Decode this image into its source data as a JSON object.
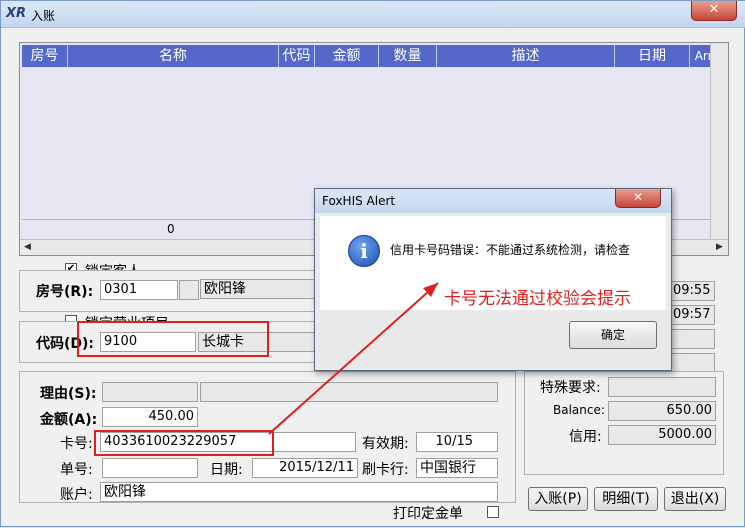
{
  "window": {
    "title": "入账",
    "close_label": "✕"
  },
  "grid": {
    "columns": [
      "房号",
      "名称",
      "代码",
      "金额",
      "数量",
      "描述",
      "日期",
      "Arr."
    ],
    "sum_qty": "0"
  },
  "guest": {
    "lock_label": "锁定客人",
    "lock_checked": "✔",
    "room_label": "房号(R):",
    "room_value": "0301",
    "name_value": "欧阳锋"
  },
  "item": {
    "lock_label": "锁定营业项目",
    "code_label": "代码(D):",
    "code_value": "9100",
    "code_name": "长城卡"
  },
  "detail": {
    "reason_label": "理由(S):",
    "amount_label": "金额(A):",
    "amount_value": "450.00",
    "card_label": "卡号:",
    "card_value": "4033610023229057",
    "expiry_label": "有效期:",
    "expiry_value": "10/15",
    "voucher_label": "单号:",
    "date_label": "日期:",
    "date_value": "2015/12/11",
    "bank_label": "刷卡行:",
    "bank_value": "中国银行",
    "account_label": "账户:",
    "account_value": "欧阳锋",
    "print_label": "打印定金单"
  },
  "right_panel": {
    "time1": "09:55",
    "time2": "09:57",
    "special_label": "特殊要求:",
    "balance_label": "Balance:",
    "balance_value": "650.00",
    "credit_label": "信用:",
    "credit_value": "5000.00"
  },
  "buttons": {
    "post": "入账(P)",
    "detail": "明细(T)",
    "exit": "退出(X)"
  },
  "dialog": {
    "title": "FoxHIS Alert",
    "close_label": "✕",
    "message": "信用卡号码错误：不能通过系统检测，请检查",
    "ok": "确定"
  },
  "annotation": "卡号无法通过校验会提示",
  "colors": {
    "grid_header": "#5468c9",
    "annotation_red": "#e02020"
  }
}
